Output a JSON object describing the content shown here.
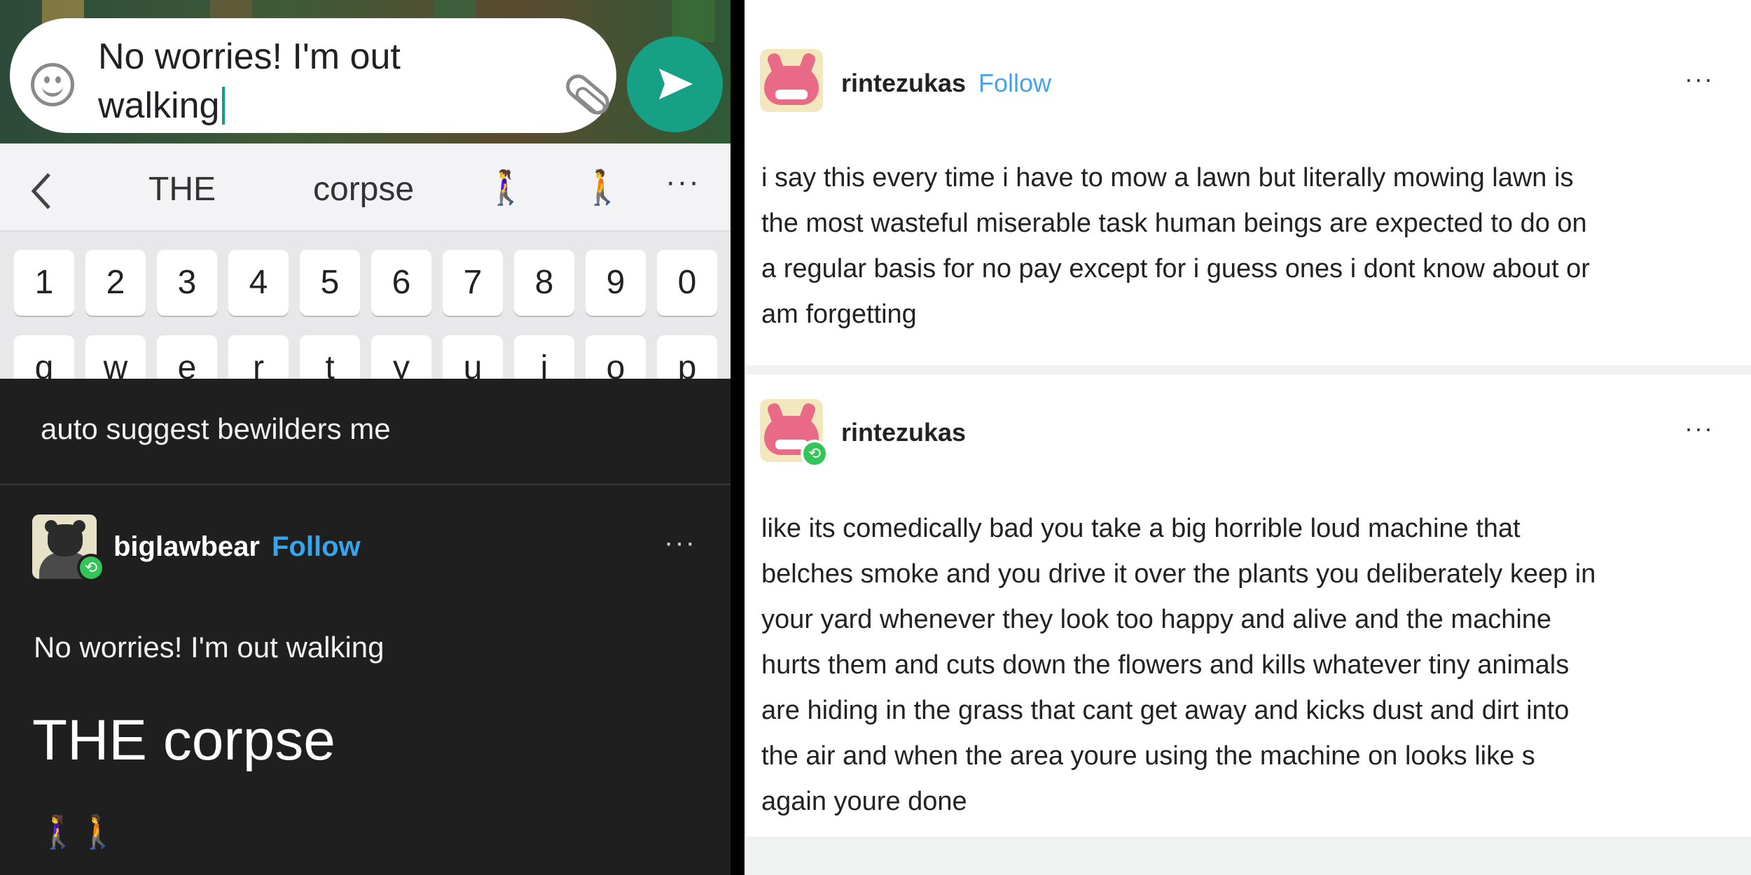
{
  "chat": {
    "message_line1": "No worries! I'm out",
    "message_line2": "walking"
  },
  "suggestions": {
    "words": [
      "THE",
      "corpse"
    ],
    "emoji": [
      "🚶‍♀️",
      "🚶"
    ],
    "more": "···"
  },
  "keyboard": {
    "number_row": [
      "1",
      "2",
      "3",
      "4",
      "5",
      "6",
      "7",
      "8",
      "9",
      "0"
    ],
    "letter_row": [
      "q",
      "w",
      "e",
      "r",
      "t",
      "y",
      "u",
      "i",
      "o",
      "p"
    ]
  },
  "dark_post": {
    "comment": "auto suggest bewilders me",
    "username": "biglawbear",
    "follow": "Follow",
    "more": "···",
    "line1": "No worries! I'm out walking",
    "line2": "THE corpse",
    "emoji": "🚶‍♀️🚶"
  },
  "light_post_1": {
    "username": "rintezukas",
    "follow": "Follow",
    "more": "···",
    "lines": [
      "i say this every time i have to mow a lawn but literally mowing lawn is",
      "the most wasteful miserable task human beings are expected to do on",
      "a regular basis for no pay except for i guess ones i dont know about or",
      "am forgetting"
    ]
  },
  "light_post_2": {
    "username": "rintezukas",
    "more": "···",
    "lines": [
      "like its comedically bad you take a big horrible loud machine that",
      "belches smoke and you drive it over the plants you deliberately keep in",
      "your yard whenever they look too happy and alive and the machine",
      "hurts them and cuts down the flowers and kills whatever tiny animals",
      "are hiding in the grass that cant get away and kicks dust and dirt into",
      "the air and when the area youre using the machine on looks like s",
      "again youre done"
    ]
  },
  "colors": {
    "send_button": "#16a085",
    "follow_link": "#34a6ee",
    "reblog_badge": "#33c45a",
    "dark_background": "#1f1f1f"
  },
  "icons": {
    "chat_emoji": "smiley-icon",
    "chat_attach": "paperclip-icon",
    "chat_send": "send-icon",
    "suggest_back": "chevron-left-icon",
    "reblog": "reblog-icon"
  }
}
